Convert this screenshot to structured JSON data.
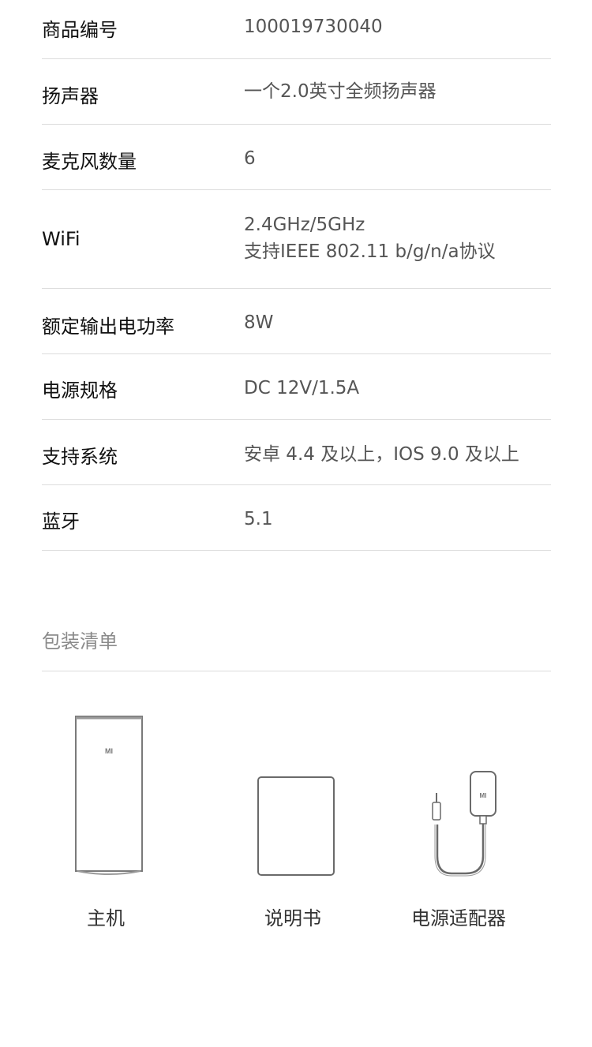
{
  "specs": [
    {
      "label": "商品编号",
      "value": [
        "100019730040"
      ]
    },
    {
      "label": "扬声器",
      "value": [
        "一个2.0英寸全频扬声器"
      ]
    },
    {
      "label": "麦克风数量",
      "value": [
        "6"
      ]
    },
    {
      "label": "WiFi",
      "value": [
        "2.4GHz/5GHz",
        "支持IEEE 802.11 b/g/n/a协议"
      ]
    },
    {
      "label": "额定输出电功率",
      "value": [
        "8W"
      ]
    },
    {
      "label": "电源规格",
      "value": [
        "DC 12V/1.5A"
      ]
    },
    {
      "label": "支持系统",
      "value": [
        "安卓 4.4 及以上，IOS 9.0 及以上"
      ]
    },
    {
      "label": "蓝牙",
      "value": [
        "5.1"
      ]
    }
  ],
  "package": {
    "title": "包装清单",
    "items": [
      {
        "label": "主机",
        "icon": "speaker-unit-icon",
        "logo": "MI"
      },
      {
        "label": "说明书",
        "icon": "manual-icon"
      },
      {
        "label": "电源适配器",
        "icon": "power-adapter-icon",
        "logo": "MI"
      }
    ]
  },
  "colors": {
    "divider": "#dcdcdc",
    "label": "#111111",
    "value": "#555555",
    "section_title": "#8a8a8a",
    "illustration": "#7a7a7a"
  }
}
